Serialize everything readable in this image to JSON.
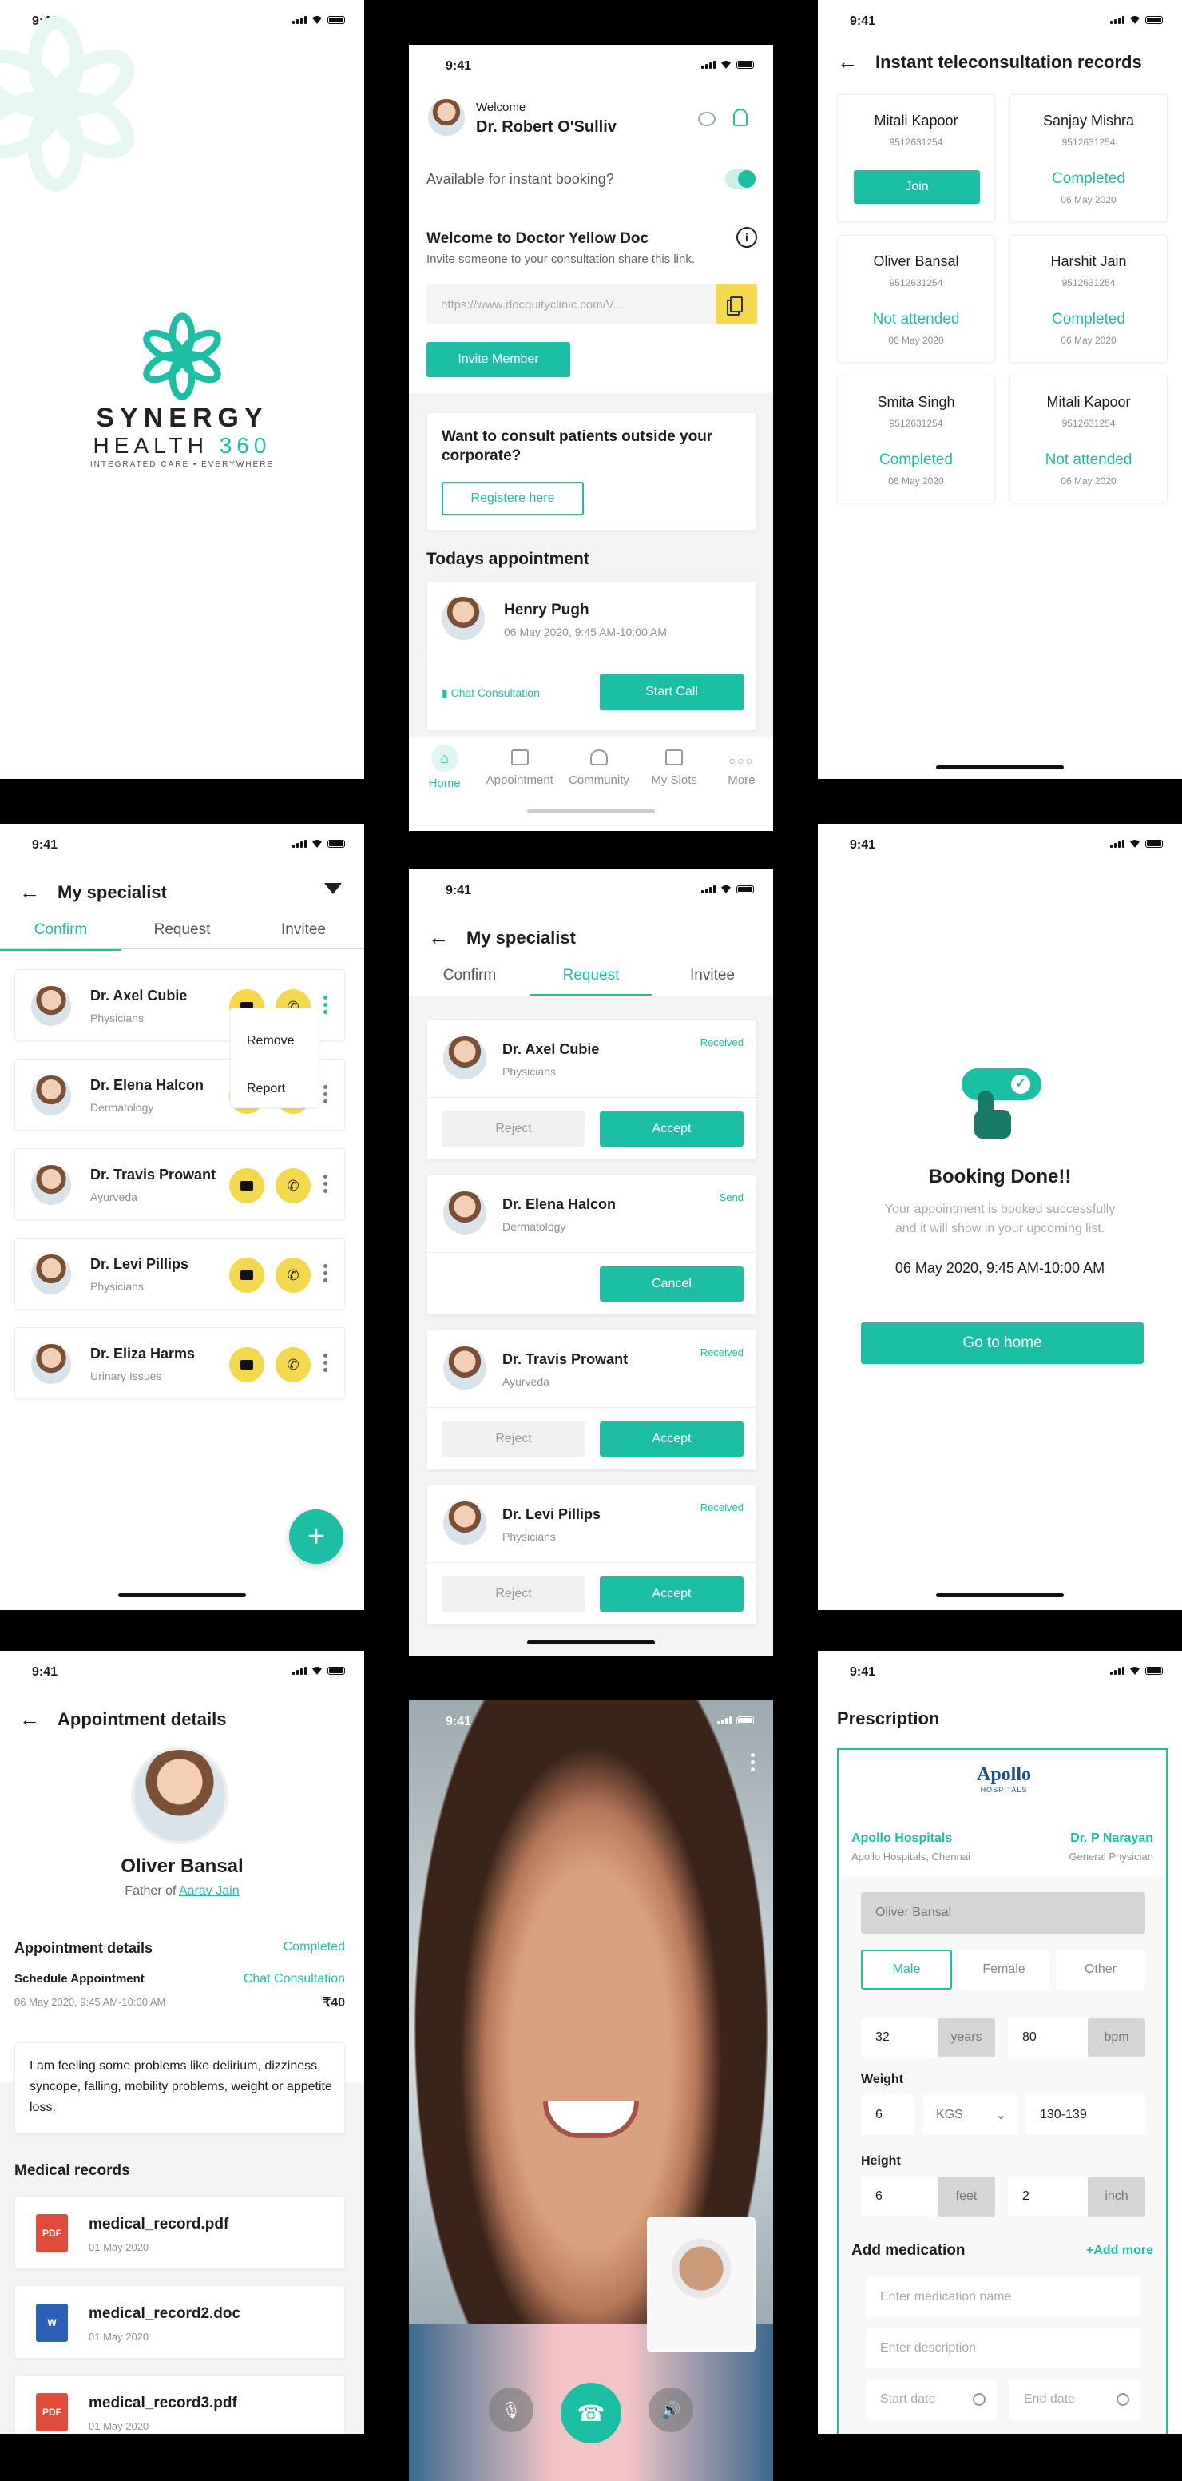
{
  "status_time": "9:41",
  "colors": {
    "accent": "#1dbfa4",
    "yellow": "#f4d84e",
    "gray": "#f2f2f2"
  },
  "splash": {
    "brand_top": "SYNERGY",
    "brand_health": "HEALTH",
    "brand_num": "360",
    "tagline": "INTEGRATED CARE • EVERYWHERE"
  },
  "home": {
    "welcome": "Welcome",
    "doctor": "Dr. Robert O'Sulliv",
    "available": "Available for instant booking?",
    "welcome_title": "Welcome to Doctor Yellow Doc",
    "invite_text": "Invite someone to your consultation share this link.",
    "link_placeholder": "https://www.docquityclinic.com/V...",
    "invite_btn": "Invite Member",
    "outside_title": "Want to consult patients outside your corporate?",
    "register_btn": "Registere here",
    "today_title": "Todays appointment",
    "patient": "Henry Pugh",
    "appt_time": "06 May 2020, 9:45 AM-10:00 AM",
    "chat": "Chat Consultation",
    "start_call": "Start Call",
    "nav": [
      "Home",
      "Appointment",
      "Community",
      "My Slots",
      "More"
    ]
  },
  "records": {
    "title": "Instant teleconsultation records",
    "join": "Join",
    "items": [
      {
        "name": "Mitali Kapoor",
        "phone": "9512631254",
        "status": "Join",
        "date": ""
      },
      {
        "name": "Sanjay Mishra",
        "phone": "9512631254",
        "status": "Completed",
        "date": "06 May 2020"
      },
      {
        "name": "Oliver Bansal",
        "phone": "9512631254",
        "status": "Not attended",
        "date": "06 May 2020"
      },
      {
        "name": "Harshit Jain",
        "phone": "9512631254",
        "status": "Completed",
        "date": "06 May 2020"
      },
      {
        "name": "Smita Singh",
        "phone": "9512631254",
        "status": "Completed",
        "date": "06 May 2020"
      },
      {
        "name": "Mitali Kapoor",
        "phone": "9512631254",
        "status": "Not attended",
        "date": "06 May 2020"
      }
    ]
  },
  "specialist": {
    "title": "My specialist",
    "tabs": [
      "Confirm",
      "Request",
      "Invitee"
    ],
    "items": [
      {
        "name": "Dr. Axel Cubie",
        "spec": "Physicians"
      },
      {
        "name": "Dr. Elena Halcon",
        "spec": "Dermatology"
      },
      {
        "name": "Dr. Travis Prowant",
        "spec": "Ayurveda"
      },
      {
        "name": "Dr. Levi Pillips",
        "spec": "Physicians"
      },
      {
        "name": "Dr. Eliza Harms",
        "spec": "Urinary Issues"
      }
    ],
    "menu": [
      "Remove",
      "Report"
    ],
    "fab": "+"
  },
  "requests": {
    "title": "My specialist",
    "tabs": [
      "Confirm",
      "Request",
      "Invitee"
    ],
    "reject": "Reject",
    "accept": "Accept",
    "cancel": "Cancel",
    "items": [
      {
        "name": "Dr. Axel Cubie",
        "spec": "Physicians",
        "status": "Received"
      },
      {
        "name": "Dr. Elena Halcon",
        "spec": "Dermatology",
        "status": "Send"
      },
      {
        "name": "Dr. Travis Prowant",
        "spec": "Ayurveda",
        "status": "Received"
      },
      {
        "name": "Dr. Levi Pillips",
        "spec": "Physicians",
        "status": "Received"
      }
    ]
  },
  "booking": {
    "title": "Booking Done!!",
    "desc1": "Your appointment is booked successfully",
    "desc2": "and it will show in your upcoming list.",
    "datetime": "06 May 2020, 9:45 AM-10:00 AM",
    "btn": "Go to home"
  },
  "appt": {
    "title": "Appointment details",
    "name": "Oliver Bansal",
    "father_label": "Father of",
    "father": "Aarav Jain",
    "section": "Appointment details",
    "status": "Completed",
    "sched": "Schedule Appointment",
    "type": "Chat Consultation",
    "datetime": "06 May 2020, 9:45 AM-10:00 AM",
    "price": "₹40",
    "note": "I am feeling some problems like delirium, dizziness, syncope, falling, mobility problems, weight or appetite loss.",
    "records_title": "Medical records",
    "files": [
      {
        "name": "medical_record.pdf",
        "date": "01 May 2020",
        "type": "PDF"
      },
      {
        "name": "medical_record2.doc",
        "date": "01 May 2020",
        "type": "W"
      },
      {
        "name": "medical_record3.pdf",
        "date": "01 May 2020",
        "type": "PDF"
      }
    ]
  },
  "rx": {
    "title": "Prescription",
    "hospital": "Apollo Hospitals",
    "hospital_addr": "Apollo Hospitals, Chennai",
    "logo_text": "Apollo",
    "logo_sub": "HOSPITALS",
    "doctor": "Dr. P Narayan",
    "doctor_spec": "General Physician",
    "patient": "Oliver Bansal",
    "genders": [
      "Male",
      "Female",
      "Other"
    ],
    "age": "32",
    "age_unit": "years",
    "bpm": "80",
    "bpm_unit": "bpm",
    "weight_label": "Weight",
    "weight": "6",
    "weight_unit": "KGS",
    "weight_range": "130-139",
    "height_label": "Height",
    "height_ft": "6",
    "ft_unit": "feet",
    "height_in": "2",
    "in_unit": "inch",
    "med_title": "Add medication",
    "add_more": "+Add more",
    "med_name": "Enter medication name",
    "med_desc": "Enter description",
    "start": "Start date",
    "end": "End date"
  }
}
